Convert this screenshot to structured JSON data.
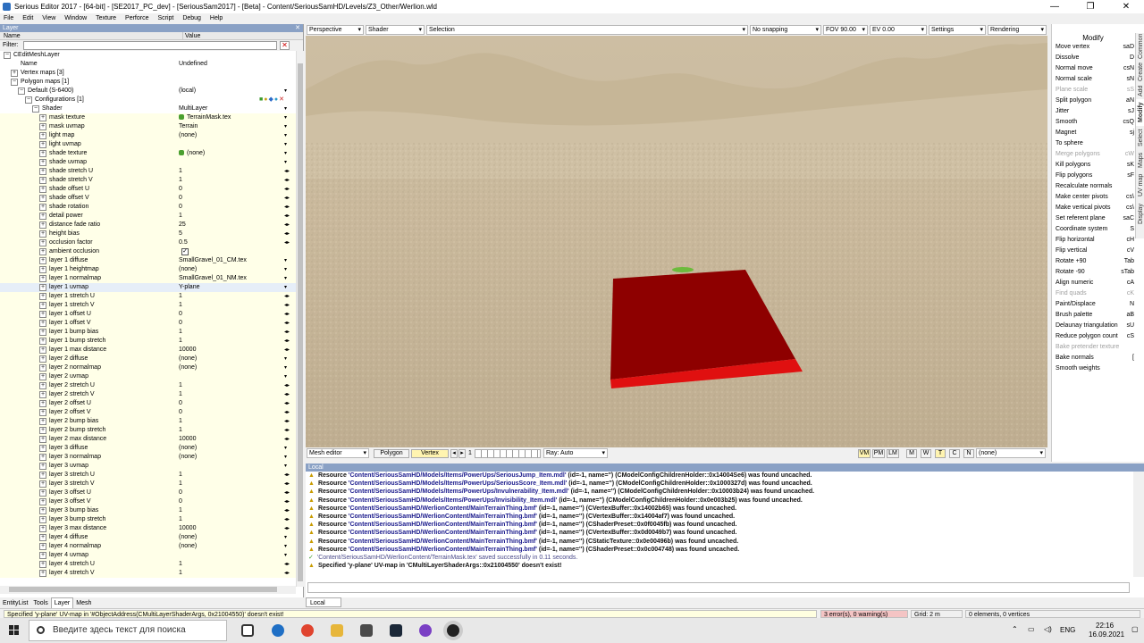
{
  "window": {
    "title": "Serious Editor 2017 - [64-bit] - [SE2017_PC_dev] - [SeriousSam2017] - [Beta] - Content/SeriousSamHD/Levels/Z3_Other/Werlion.wld",
    "minimize": "—",
    "maximize": "❐",
    "close": "✕"
  },
  "menu": [
    "File",
    "Edit",
    "View",
    "Window",
    "Texture",
    "Perforce",
    "Script",
    "Debug",
    "Help"
  ],
  "layer_panel": {
    "title": "Layer",
    "col_name": "Name",
    "col_value": "Value",
    "filter_label": "Filter:",
    "filter_value": "",
    "rows": [
      {
        "name": "CEditMeshLayer",
        "value": "",
        "indent": 0,
        "exp": "−"
      },
      {
        "name": "Name",
        "value": "Undefined",
        "indent": 1,
        "exp": ""
      },
      {
        "name": "Vertex maps [3]",
        "value": "",
        "indent": 1,
        "exp": "+"
      },
      {
        "name": "Polygon maps [1]",
        "value": "",
        "indent": 1,
        "exp": "−"
      },
      {
        "name": "Default (S-6400)",
        "value": "(local)",
        "indent": 2,
        "exp": "−",
        "arrow": "▾"
      },
      {
        "name": "Configurations [1]",
        "value": "",
        "indent": 3,
        "exp": "−",
        "icons": true
      },
      {
        "name": "Shader",
        "value": "MultiLayer",
        "indent": 4,
        "exp": "−",
        "arrow": "▾"
      },
      {
        "name": "mask texture",
        "value": "TerrainMask.tex",
        "indent": 5,
        "exp": "+",
        "arrow": "▾",
        "gem": true
      },
      {
        "name": "mask uvmap",
        "value": "Terrain",
        "indent": 5,
        "exp": "+",
        "arrow": "▾"
      },
      {
        "name": "light map",
        "value": "(none)",
        "indent": 5,
        "exp": "+",
        "arrow": "▾"
      },
      {
        "name": "light uvmap",
        "value": "",
        "indent": 5,
        "exp": "+",
        "arrow": "▾"
      },
      {
        "name": "shade texture",
        "value": "(none)",
        "indent": 5,
        "exp": "+",
        "arrow": "▾",
        "gem": true
      },
      {
        "name": "shade uvmap",
        "value": "",
        "indent": 5,
        "exp": "+",
        "arrow": "▾"
      },
      {
        "name": "shade stretch U",
        "value": "1",
        "indent": 5,
        "exp": "+",
        "arrow": "◂▸"
      },
      {
        "name": "shade stretch V",
        "value": "1",
        "indent": 5,
        "exp": "+",
        "arrow": "◂▸"
      },
      {
        "name": "shade offset U",
        "value": "0",
        "indent": 5,
        "exp": "+",
        "arrow": "◂▸"
      },
      {
        "name": "shade offset V",
        "value": "0",
        "indent": 5,
        "exp": "+",
        "arrow": "◂▸"
      },
      {
        "name": "shade rotation",
        "value": "0",
        "indent": 5,
        "exp": "+",
        "arrow": "◂▸"
      },
      {
        "name": "detail power",
        "value": "1",
        "indent": 5,
        "exp": "+",
        "arrow": "◂▸"
      },
      {
        "name": "distance fade ratio",
        "value": "25",
        "indent": 5,
        "exp": "+",
        "arrow": "◂▸"
      },
      {
        "name": "height bias",
        "value": "5",
        "indent": 5,
        "exp": "+",
        "arrow": "◂▸"
      },
      {
        "name": "occlusion factor",
        "value": "0.5",
        "indent": 5,
        "exp": "+",
        "arrow": "◂▸"
      },
      {
        "name": "ambient occlusion",
        "value": "",
        "indent": 5,
        "exp": "+",
        "check": "✓"
      },
      {
        "name": "layer 1 diffuse",
        "value": "SmallGravel_01_CM.tex",
        "indent": 5,
        "exp": "+",
        "arrow": "▾"
      },
      {
        "name": "layer 1 heightmap",
        "value": "(none)",
        "indent": 5,
        "exp": "+",
        "arrow": "▾"
      },
      {
        "name": "layer 1 normalmap",
        "value": "SmallGravel_01_NM.tex",
        "indent": 5,
        "exp": "+",
        "arrow": "▾"
      },
      {
        "name": "layer 1 uvmap",
        "value": "Y-plane",
        "indent": 5,
        "exp": "+",
        "arrow": "▾",
        "sel": true
      },
      {
        "name": "layer 1 stretch U",
        "value": "1",
        "indent": 5,
        "exp": "+",
        "arrow": "◂▸"
      },
      {
        "name": "layer 1 stretch V",
        "value": "1",
        "indent": 5,
        "exp": "+",
        "arrow": "◂▸"
      },
      {
        "name": "layer 1 offset U",
        "value": "0",
        "indent": 5,
        "exp": "+",
        "arrow": "◂▸"
      },
      {
        "name": "layer 1 offset V",
        "value": "0",
        "indent": 5,
        "exp": "+",
        "arrow": "◂▸"
      },
      {
        "name": "layer 1 bump bias",
        "value": "1",
        "indent": 5,
        "exp": "+",
        "arrow": "◂▸"
      },
      {
        "name": "layer 1 bump stretch",
        "value": "1",
        "indent": 5,
        "exp": "+",
        "arrow": "◂▸"
      },
      {
        "name": "layer 1 max distance",
        "value": "10000",
        "indent": 5,
        "exp": "+",
        "arrow": "◂▸"
      },
      {
        "name": "layer 2 diffuse",
        "value": "(none)",
        "indent": 5,
        "exp": "+",
        "arrow": "▾"
      },
      {
        "name": "layer 2 normalmap",
        "value": "(none)",
        "indent": 5,
        "exp": "+",
        "arrow": "▾"
      },
      {
        "name": "layer 2 uvmap",
        "value": "",
        "indent": 5,
        "exp": "+",
        "arrow": "▾"
      },
      {
        "name": "layer 2 stretch U",
        "value": "1",
        "indent": 5,
        "exp": "+",
        "arrow": "◂▸"
      },
      {
        "name": "layer 2 stretch V",
        "value": "1",
        "indent": 5,
        "exp": "+",
        "arrow": "◂▸"
      },
      {
        "name": "layer 2 offset U",
        "value": "0",
        "indent": 5,
        "exp": "+",
        "arrow": "◂▸"
      },
      {
        "name": "layer 2 offset V",
        "value": "0",
        "indent": 5,
        "exp": "+",
        "arrow": "◂▸"
      },
      {
        "name": "layer 2 bump bias",
        "value": "1",
        "indent": 5,
        "exp": "+",
        "arrow": "◂▸"
      },
      {
        "name": "layer 2 bump stretch",
        "value": "1",
        "indent": 5,
        "exp": "+",
        "arrow": "◂▸"
      },
      {
        "name": "layer 2 max distance",
        "value": "10000",
        "indent": 5,
        "exp": "+",
        "arrow": "◂▸"
      },
      {
        "name": "layer 3 diffuse",
        "value": "(none)",
        "indent": 5,
        "exp": "+",
        "arrow": "▾"
      },
      {
        "name": "layer 3 normalmap",
        "value": "(none)",
        "indent": 5,
        "exp": "+",
        "arrow": "▾"
      },
      {
        "name": "layer 3 uvmap",
        "value": "",
        "indent": 5,
        "exp": "+",
        "arrow": "▾"
      },
      {
        "name": "layer 3 stretch U",
        "value": "1",
        "indent": 5,
        "exp": "+",
        "arrow": "◂▸"
      },
      {
        "name": "layer 3 stretch V",
        "value": "1",
        "indent": 5,
        "exp": "+",
        "arrow": "◂▸"
      },
      {
        "name": "layer 3 offset U",
        "value": "0",
        "indent": 5,
        "exp": "+",
        "arrow": "◂▸"
      },
      {
        "name": "layer 3 offset V",
        "value": "0",
        "indent": 5,
        "exp": "+",
        "arrow": "◂▸"
      },
      {
        "name": "layer 3 bump bias",
        "value": "1",
        "indent": 5,
        "exp": "+",
        "arrow": "◂▸"
      },
      {
        "name": "layer 3 bump stretch",
        "value": "1",
        "indent": 5,
        "exp": "+",
        "arrow": "◂▸"
      },
      {
        "name": "layer 3 max distance",
        "value": "10000",
        "indent": 5,
        "exp": "+",
        "arrow": "◂▸"
      },
      {
        "name": "layer 4 diffuse",
        "value": "(none)",
        "indent": 5,
        "exp": "+",
        "arrow": "▾"
      },
      {
        "name": "layer 4 normalmap",
        "value": "(none)",
        "indent": 5,
        "exp": "+",
        "arrow": "▾"
      },
      {
        "name": "layer 4 uvmap",
        "value": "",
        "indent": 5,
        "exp": "+",
        "arrow": "▾"
      },
      {
        "name": "layer 4 stretch U",
        "value": "1",
        "indent": 5,
        "exp": "+",
        "arrow": "◂▸"
      },
      {
        "name": "layer 4 stretch V",
        "value": "1",
        "indent": 5,
        "exp": "+",
        "arrow": "◂▸"
      }
    ],
    "tabs": [
      "EntityList",
      "Tools",
      "Layer",
      "Mesh"
    ],
    "active_tab": "Layer"
  },
  "viewport_toolbar": {
    "projection": "Perspective",
    "shader": "Shader",
    "selection": "Selection",
    "snapping": "No snapping",
    "fov": "FOV 90.00",
    "ev": "EV 0.00",
    "settings": "Settings",
    "rendering": "Rendering"
  },
  "viewport_bottombar": {
    "mode": "Mesh editor",
    "polygon": "Polygon",
    "vertex": "Vertex",
    "page": "1",
    "ray": "Ray: Auto",
    "toggles": [
      "VM",
      "PM",
      "LM",
      "M",
      "W",
      "T",
      "C",
      "N"
    ],
    "active_toggle": "T",
    "extra": "(none)"
  },
  "log": {
    "title": "Local",
    "lines": [
      {
        "t": "warn",
        "path": "'Content/SeriousSamHD/Models/Items/PowerUps/SeriousJump_Item.mdl'",
        "rest": " (id=-1, name='') (CModelConfigChildrenHolder::0x14004Se6) was found uncached."
      },
      {
        "t": "warn",
        "path": "'Content/SeriousSamHD/Models/Items/PowerUps/SeriousScore_Item.mdl'",
        "rest": " (id=-1, name='') (CModelConfigChildrenHolder::0x1000327d) was found uncached."
      },
      {
        "t": "warn",
        "path": "'Content/SeriousSamHD/Models/Items/PowerUps/Invulnerability_Item.mdl'",
        "rest": " (id=-1, name='') (CModelConfigChildrenHolder::0x10003b24) was found uncached."
      },
      {
        "t": "warn",
        "path": "'Content/SeriousSamHD/Models/Items/PowerUps/Invisibility_Item.mdl'",
        "rest": " (id=-1, name='') (CModelConfigChildrenHolder::0x0e003b25) was found uncached."
      },
      {
        "t": "warn",
        "path": "'Content/SeriousSamHD/WerlionContent/MainTerrainThing.bmf'",
        "rest": " (id=-1, name='') (CVertexBuffer::0x14002b65) was found uncached."
      },
      {
        "t": "warn",
        "path": "'Content/SeriousSamHD/WerlionContent/MainTerrainThing.bmf'",
        "rest": " (id=-1, name='') (CVertexBuffer::0x14004af7) was found uncached."
      },
      {
        "t": "warn",
        "path": "'Content/SeriousSamHD/WerlionContent/MainTerrainThing.bmf'",
        "rest": " (id=-1, name='') (CShaderPreset::0x0f0045fb) was found uncached."
      },
      {
        "t": "warn",
        "path": "'Content/SeriousSamHD/WerlionContent/MainTerrainThing.bmf'",
        "rest": " (id=-1, name='') (CVertexBuffer::0x0d0049b7) was found uncached."
      },
      {
        "t": "warn",
        "path": "'Content/SeriousSamHD/WerlionContent/MainTerrainThing.bmf'",
        "rest": " (id=-1, name='') (CStaticTexture::0x0e00496b) was found uncached."
      },
      {
        "t": "warn",
        "path": "'Content/SeriousSamHD/WerlionContent/MainTerrainThing.bmf'",
        "rest": " (id=-1, name='') (CShaderPreset::0x0c004748) was found uncached."
      },
      {
        "t": "ok",
        "path": "'Content/SeriousSamHD/WerlionContent/TerrainMask.tex'",
        "rest": " saved successfully in 0.11 seconds."
      },
      {
        "t": "plain",
        "path": "Specified 'y-plane' UV-map in 'CMultiLayerShaderArgs::0x21004550'",
        "rest": " doesn't exist!"
      }
    ],
    "warn_prefix": "Resource",
    "tab": "Local"
  },
  "modify_panel": {
    "title": "Modify",
    "tools": [
      {
        "l": "Move vertex",
        "s": "saD"
      },
      {
        "l": "Dissolve",
        "s": "D"
      },
      {
        "l": "Normal move",
        "s": "csN"
      },
      {
        "l": "Normal scale",
        "s": "sN"
      },
      {
        "l": "Plane scale",
        "s": "sS",
        "dis": true
      },
      {
        "l": "Split polygon",
        "s": "aN"
      },
      {
        "l": "Jitter",
        "s": "sJ"
      },
      {
        "l": "Smooth",
        "s": "csQ"
      },
      {
        "l": "Magnet",
        "s": "sj"
      },
      {
        "l": "To sphere",
        "s": ""
      },
      {
        "l": "Merge polygons",
        "s": "cW",
        "dis": true
      },
      {
        "l": "Kill polygons",
        "s": "sK"
      },
      {
        "l": "Flip polygons",
        "s": "sF"
      },
      {
        "l": "Recalculate normals",
        "s": ""
      },
      {
        "l": "Make center pivots",
        "s": "cs\\"
      },
      {
        "l": "Make vertical pivots",
        "s": "cs\\"
      },
      {
        "l": "Set referent plane",
        "s": "saC"
      },
      {
        "l": "Coordinate system",
        "s": "S"
      },
      {
        "l": "Flip horizontal",
        "s": "cH"
      },
      {
        "l": "Flip vertical",
        "s": "cV"
      },
      {
        "l": "Rotate +90",
        "s": "Tab"
      },
      {
        "l": "Rotate -90",
        "s": "sTab"
      },
      {
        "l": "Align numeric",
        "s": "cA"
      },
      {
        "l": "Find quads",
        "s": "cK",
        "dis": true
      },
      {
        "l": "Paint/Displace",
        "s": "N"
      },
      {
        "l": "Brush palette",
        "s": "aB"
      },
      {
        "l": "Delaunay triangulation",
        "s": "sU"
      },
      {
        "l": "Reduce polygon count",
        "s": "cS"
      },
      {
        "l": "Bake pretender texture",
        "s": "",
        "dis": true
      },
      {
        "l": "Bake normals",
        "s": "["
      },
      {
        "l": "Smooth weights",
        "s": ""
      }
    ],
    "vtabs": [
      "Common",
      "Create",
      "Add",
      "Modify",
      "Select",
      "Maps",
      "UV map",
      "Display"
    ],
    "active_vtab": "Modify"
  },
  "statusbar": {
    "message": "Specified 'y-plane' UV-map in '#ObjectAddress(CMultiLayerShaderArgs, 0x21004550)' doesn't exist!",
    "errors": "3 error(s), 0 warning(s)",
    "grid": "Grid: 2 m",
    "elements": "0 elements, 0 vertices"
  },
  "taskbar": {
    "search_placeholder": "Введите здесь текст для поиска",
    "lang": "ENG",
    "time": "22:16",
    "date": "16.09.2021"
  }
}
